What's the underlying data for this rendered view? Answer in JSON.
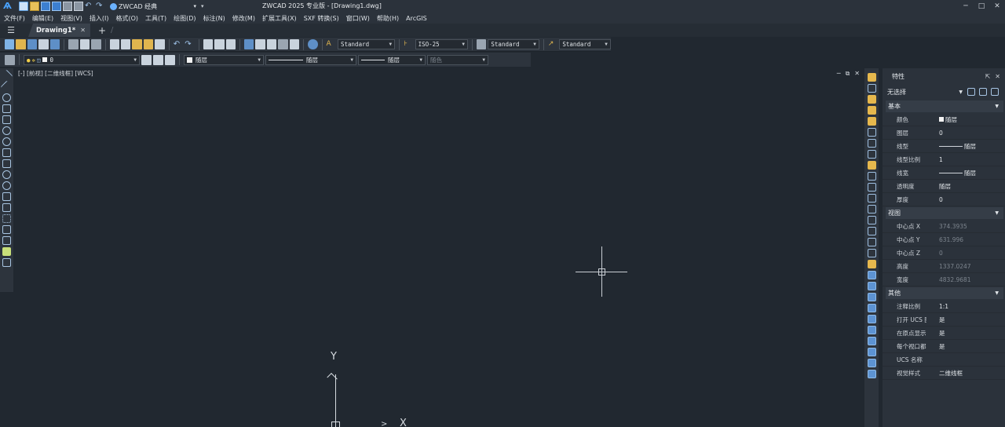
{
  "app": {
    "logo_icon": "zwcad-logo-icon",
    "workspace": "ZWCAD 经典",
    "title": "ZWCAD 2025 专业版 - [Drawing1.dwg]"
  },
  "window_controls": [
    "─",
    "□",
    "✕"
  ],
  "menu": [
    "文件(F)",
    "编辑(E)",
    "视图(V)",
    "插入(I)",
    "格式(O)",
    "工具(T)",
    "绘图(D)",
    "标注(N)",
    "修改(M)",
    "扩展工具(X)",
    "SXF 转换(S)",
    "窗口(W)",
    "帮助(H)",
    "ArcGIS"
  ],
  "tabs": {
    "active": "Drawing1*",
    "close": "✕",
    "add": "+"
  },
  "toolbar1": {
    "text_style": "Standard",
    "dim_style": "ISO-25",
    "table_style": "Standard",
    "multileader_style": "Standard"
  },
  "toolbar2": {
    "layer": "0",
    "color": "随层",
    "linetype": "随层",
    "lineweight": "随层",
    "plotstyle": "随色"
  },
  "viewport": {
    "label": "[-] [前视] [二维线框] [WCS]",
    "controls": [
      "─",
      "⧉",
      "✕"
    ],
    "ucs_y": "Y",
    "ucs_x": "X"
  },
  "properties": {
    "title": "特性",
    "selection": "无选择",
    "sections": [
      {
        "name": "基本",
        "rows": [
          {
            "k": "颜色",
            "v": "随层",
            "type": "color"
          },
          {
            "k": "图层",
            "v": "0"
          },
          {
            "k": "线型",
            "v": "随层",
            "type": "line"
          },
          {
            "k": "线型比例",
            "v": "1"
          },
          {
            "k": "线宽",
            "v": "随层",
            "type": "line"
          },
          {
            "k": "透明度",
            "v": "随层"
          },
          {
            "k": "厚度",
            "v": "0"
          }
        ]
      },
      {
        "name": "视图",
        "rows": [
          {
            "k": "中心点 X",
            "v": "374.3935",
            "dim": true
          },
          {
            "k": "中心点 Y",
            "v": "631.996",
            "dim": true
          },
          {
            "k": "中心点 Z",
            "v": "0",
            "dim": true
          },
          {
            "k": "高度",
            "v": "1337.0247",
            "dim": true
          },
          {
            "k": "宽度",
            "v": "4832.9681",
            "dim": true
          }
        ]
      },
      {
        "name": "其他",
        "rows": [
          {
            "k": "注释比例",
            "v": "1:1"
          },
          {
            "k": "打开 UCS 图...",
            "v": "是"
          },
          {
            "k": "在原点显示 ...",
            "v": "是"
          },
          {
            "k": "每个视口都...",
            "v": "是"
          },
          {
            "k": "UCS 名称",
            "v": ""
          },
          {
            "k": "视觉样式",
            "v": "二维线框"
          }
        ]
      }
    ]
  }
}
